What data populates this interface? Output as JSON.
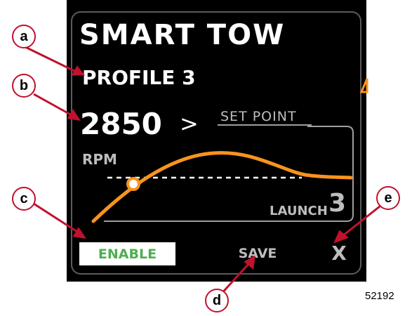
{
  "screen": {
    "title": "SMART TOW",
    "profile": "PROFILE 3",
    "rpm_value": "2850",
    "rpm_arrow": ">",
    "set_point_label": "SET POINT",
    "rpm_unit": "RPM",
    "launch_label": "LAUNCH",
    "launch_value": "3"
  },
  "buttons": {
    "enable": "ENABLE",
    "save": "SAVE",
    "close": "X"
  },
  "callouts": [
    "a",
    "b",
    "c",
    "d",
    "e"
  ],
  "figure_id": "52192",
  "colors": {
    "background": "#000000",
    "curve": "#f7941d",
    "enable_text": "#4caf50",
    "callout": "#c0112d",
    "muted_text": "#bdbdbd"
  }
}
